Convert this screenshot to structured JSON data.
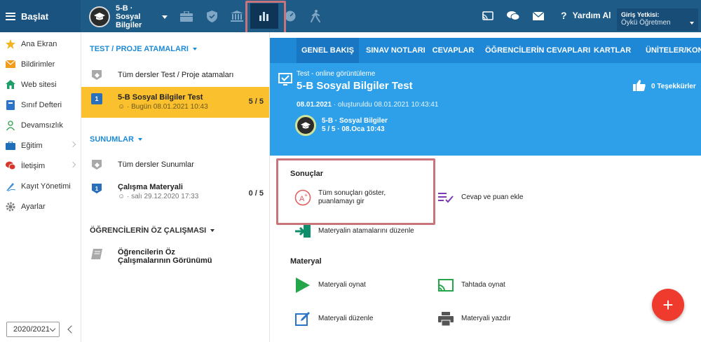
{
  "topbar": {
    "brand_label": "Başlat",
    "class_name": "5-B · Sosyal Bilgiler",
    "help_label": "Yardım Al",
    "auth_title": "Giriş Yetkisi:",
    "auth_value": "Öykü Öğretmen",
    "icons": [
      "briefcase-icon",
      "shield-icon",
      "bank-icon",
      "bar-chart-icon",
      "meter-icon",
      "walk-icon",
      "cast-icon",
      "chat-icon",
      "mail-icon"
    ]
  },
  "nav": {
    "items": [
      {
        "label": "Ana Ekran",
        "icon": "star-icon"
      },
      {
        "label": "Bildirimler",
        "icon": "envelope-icon"
      },
      {
        "label": "Web sitesi",
        "icon": "house-icon"
      },
      {
        "label": "Sınıf Defteri",
        "icon": "notebook-icon"
      },
      {
        "label": "Devamsızlık",
        "icon": "person-icon"
      },
      {
        "label": "Eğitim",
        "icon": "briefcase-icon"
      },
      {
        "label": "İletişim",
        "icon": "chat-icon"
      },
      {
        "label": "Kayıt Yönetimi",
        "icon": "pen-icon"
      },
      {
        "label": "Ayarlar",
        "icon": "gear-icon"
      }
    ],
    "year": "2020/2021"
  },
  "middle": {
    "sec1": "TEST / PROJE ATAMALARI",
    "all_tests": "Tüm dersler Test / Proje atamaları",
    "test_title": "5-B Sosyal Bilgiler Test",
    "test_sub": "Bugün 08.01.2021 10:43",
    "test_score": "5 / 5",
    "test_num": "1",
    "sec2": "SUNUMLAR",
    "all_pres": "Tüm dersler Sunumlar",
    "pres_title": "Çalışma Materyali",
    "pres_sub": "salı 29.12.2020 17:33",
    "pres_score": "0 / 5",
    "pres_num": "1",
    "sec3": "ÖĞRENCİLERİN ÖZ ÇALIŞMASI",
    "self_title": "Öğrencilerin Öz Çalışmalarının Görünümü"
  },
  "tabs": [
    "GENEL BAKIŞ",
    "SINAV NOTLARI",
    "CEVAPLAR",
    "ÖĞRENCİLERİN CEVAPLARI",
    "KARTLAR",
    "ÜNİTELER/KONU"
  ],
  "hero": {
    "kicker": "Test - online görüntüleme",
    "title": "5-B Sosyal Bilgiler Test",
    "date": "08.01.2021",
    "created": "· oluşturuldu 08.01.2021 10:43:41",
    "class_name": "5-B · Sosyal Bilgiler",
    "class_sub": "5 / 5 · 08.Oca 10:43",
    "thanks": "0 Teşekkürler"
  },
  "results": {
    "title": "Sonuçlar",
    "show_all": "Tüm sonuçları göster, puanlamayı gir",
    "add_answer": "Cevap ve puan ekle",
    "edit_assign": "Materyalin atamalarını düzenle"
  },
  "material": {
    "title": "Materyal",
    "play": "Materyali oynat",
    "board": "Tahtada oynat",
    "edit": "Materyali düzenle",
    "print": "Materyali yazdır"
  },
  "colors": {
    "topbar": "#1e5b86",
    "tabs": "#1e88d6",
    "hero": "#2ea0ea",
    "selected": "#fbc02d",
    "fab": "#ef3b2d",
    "highlight": "#c9737a"
  },
  "fab": {
    "label": "+"
  }
}
